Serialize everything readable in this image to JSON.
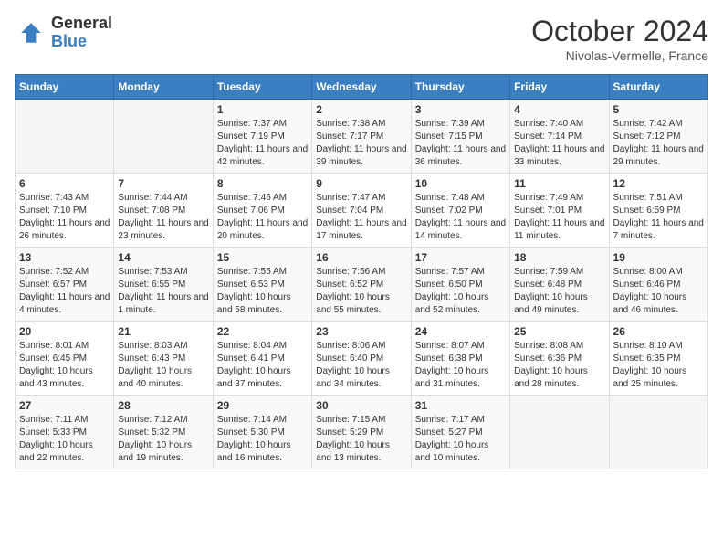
{
  "header": {
    "logo_general": "General",
    "logo_blue": "Blue",
    "month_title": "October 2024",
    "subtitle": "Nivolas-Vermelle, France"
  },
  "days_of_week": [
    "Sunday",
    "Monday",
    "Tuesday",
    "Wednesday",
    "Thursday",
    "Friday",
    "Saturday"
  ],
  "weeks": [
    [
      {
        "empty": true
      },
      {
        "empty": true
      },
      {
        "day": 1,
        "sunrise": "Sunrise: 7:37 AM",
        "sunset": "Sunset: 7:19 PM",
        "daylight": "Daylight: 11 hours and 42 minutes."
      },
      {
        "day": 2,
        "sunrise": "Sunrise: 7:38 AM",
        "sunset": "Sunset: 7:17 PM",
        "daylight": "Daylight: 11 hours and 39 minutes."
      },
      {
        "day": 3,
        "sunrise": "Sunrise: 7:39 AM",
        "sunset": "Sunset: 7:15 PM",
        "daylight": "Daylight: 11 hours and 36 minutes."
      },
      {
        "day": 4,
        "sunrise": "Sunrise: 7:40 AM",
        "sunset": "Sunset: 7:14 PM",
        "daylight": "Daylight: 11 hours and 33 minutes."
      },
      {
        "day": 5,
        "sunrise": "Sunrise: 7:42 AM",
        "sunset": "Sunset: 7:12 PM",
        "daylight": "Daylight: 11 hours and 29 minutes."
      }
    ],
    [
      {
        "day": 6,
        "sunrise": "Sunrise: 7:43 AM",
        "sunset": "Sunset: 7:10 PM",
        "daylight": "Daylight: 11 hours and 26 minutes."
      },
      {
        "day": 7,
        "sunrise": "Sunrise: 7:44 AM",
        "sunset": "Sunset: 7:08 PM",
        "daylight": "Daylight: 11 hours and 23 minutes."
      },
      {
        "day": 8,
        "sunrise": "Sunrise: 7:46 AM",
        "sunset": "Sunset: 7:06 PM",
        "daylight": "Daylight: 11 hours and 20 minutes."
      },
      {
        "day": 9,
        "sunrise": "Sunrise: 7:47 AM",
        "sunset": "Sunset: 7:04 PM",
        "daylight": "Daylight: 11 hours and 17 minutes."
      },
      {
        "day": 10,
        "sunrise": "Sunrise: 7:48 AM",
        "sunset": "Sunset: 7:02 PM",
        "daylight": "Daylight: 11 hours and 14 minutes."
      },
      {
        "day": 11,
        "sunrise": "Sunrise: 7:49 AM",
        "sunset": "Sunset: 7:01 PM",
        "daylight": "Daylight: 11 hours and 11 minutes."
      },
      {
        "day": 12,
        "sunrise": "Sunrise: 7:51 AM",
        "sunset": "Sunset: 6:59 PM",
        "daylight": "Daylight: 11 hours and 7 minutes."
      }
    ],
    [
      {
        "day": 13,
        "sunrise": "Sunrise: 7:52 AM",
        "sunset": "Sunset: 6:57 PM",
        "daylight": "Daylight: 11 hours and 4 minutes."
      },
      {
        "day": 14,
        "sunrise": "Sunrise: 7:53 AM",
        "sunset": "Sunset: 6:55 PM",
        "daylight": "Daylight: 11 hours and 1 minute."
      },
      {
        "day": 15,
        "sunrise": "Sunrise: 7:55 AM",
        "sunset": "Sunset: 6:53 PM",
        "daylight": "Daylight: 10 hours and 58 minutes."
      },
      {
        "day": 16,
        "sunrise": "Sunrise: 7:56 AM",
        "sunset": "Sunset: 6:52 PM",
        "daylight": "Daylight: 10 hours and 55 minutes."
      },
      {
        "day": 17,
        "sunrise": "Sunrise: 7:57 AM",
        "sunset": "Sunset: 6:50 PM",
        "daylight": "Daylight: 10 hours and 52 minutes."
      },
      {
        "day": 18,
        "sunrise": "Sunrise: 7:59 AM",
        "sunset": "Sunset: 6:48 PM",
        "daylight": "Daylight: 10 hours and 49 minutes."
      },
      {
        "day": 19,
        "sunrise": "Sunrise: 8:00 AM",
        "sunset": "Sunset: 6:46 PM",
        "daylight": "Daylight: 10 hours and 46 minutes."
      }
    ],
    [
      {
        "day": 20,
        "sunrise": "Sunrise: 8:01 AM",
        "sunset": "Sunset: 6:45 PM",
        "daylight": "Daylight: 10 hours and 43 minutes."
      },
      {
        "day": 21,
        "sunrise": "Sunrise: 8:03 AM",
        "sunset": "Sunset: 6:43 PM",
        "daylight": "Daylight: 10 hours and 40 minutes."
      },
      {
        "day": 22,
        "sunrise": "Sunrise: 8:04 AM",
        "sunset": "Sunset: 6:41 PM",
        "daylight": "Daylight: 10 hours and 37 minutes."
      },
      {
        "day": 23,
        "sunrise": "Sunrise: 8:06 AM",
        "sunset": "Sunset: 6:40 PM",
        "daylight": "Daylight: 10 hours and 34 minutes."
      },
      {
        "day": 24,
        "sunrise": "Sunrise: 8:07 AM",
        "sunset": "Sunset: 6:38 PM",
        "daylight": "Daylight: 10 hours and 31 minutes."
      },
      {
        "day": 25,
        "sunrise": "Sunrise: 8:08 AM",
        "sunset": "Sunset: 6:36 PM",
        "daylight": "Daylight: 10 hours and 28 minutes."
      },
      {
        "day": 26,
        "sunrise": "Sunrise: 8:10 AM",
        "sunset": "Sunset: 6:35 PM",
        "daylight": "Daylight: 10 hours and 25 minutes."
      }
    ],
    [
      {
        "day": 27,
        "sunrise": "Sunrise: 7:11 AM",
        "sunset": "Sunset: 5:33 PM",
        "daylight": "Daylight: 10 hours and 22 minutes."
      },
      {
        "day": 28,
        "sunrise": "Sunrise: 7:12 AM",
        "sunset": "Sunset: 5:32 PM",
        "daylight": "Daylight: 10 hours and 19 minutes."
      },
      {
        "day": 29,
        "sunrise": "Sunrise: 7:14 AM",
        "sunset": "Sunset: 5:30 PM",
        "daylight": "Daylight: 10 hours and 16 minutes."
      },
      {
        "day": 30,
        "sunrise": "Sunrise: 7:15 AM",
        "sunset": "Sunset: 5:29 PM",
        "daylight": "Daylight: 10 hours and 13 minutes."
      },
      {
        "day": 31,
        "sunrise": "Sunrise: 7:17 AM",
        "sunset": "Sunset: 5:27 PM",
        "daylight": "Daylight: 10 hours and 10 minutes."
      },
      {
        "empty": true
      },
      {
        "empty": true
      }
    ]
  ]
}
